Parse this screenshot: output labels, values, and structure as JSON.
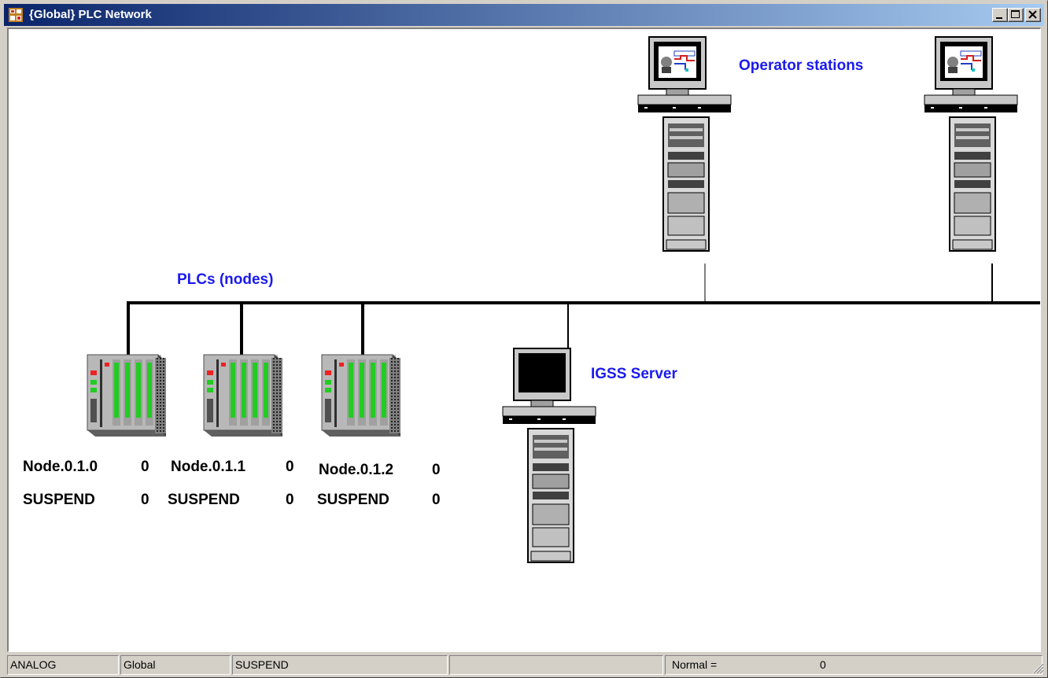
{
  "window": {
    "title": "{Global} PLC Network"
  },
  "labels": {
    "operator_stations": "Operator stations",
    "plcs": "PLCs (nodes)",
    "igss_server": "IGSS Server"
  },
  "nodes": [
    {
      "name": "Node.0.1.0",
      "name_value": "0",
      "state": "SUSPEND",
      "state_value": "0"
    },
    {
      "name": "Node.0.1.1",
      "name_value": "0",
      "state": "SUSPEND",
      "state_value": "0"
    },
    {
      "name": "Node.0.1.2",
      "name_value": "0",
      "state": "SUSPEND",
      "state_value": "0"
    }
  ],
  "statusbar": {
    "mode": "ANALOG",
    "area": "Global",
    "state": "SUSPEND",
    "empty": "",
    "normal_label": "Normal =",
    "normal_value": "0"
  },
  "colors": {
    "title_start": "#0a246a",
    "title_end": "#a6caf0",
    "label_blue": "#1a1aee",
    "plc_green": "#22cc22",
    "plc_red": "#ee2222"
  },
  "icons": [
    "app-icon",
    "minimize-icon",
    "maximize-icon",
    "close-icon",
    "workstation-icon",
    "plc-icon",
    "resize-grip-icon"
  ]
}
